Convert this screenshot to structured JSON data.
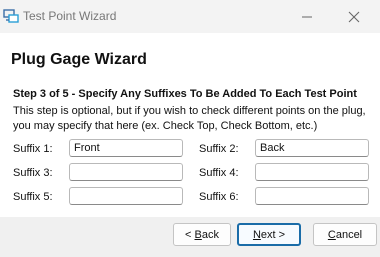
{
  "window": {
    "title": "Test Point Wizard",
    "minimize_icon": "minimize-icon",
    "close_icon": "close-icon",
    "app_icon": "wizard-app-icon"
  },
  "wizard": {
    "title": "Plug Gage Wizard",
    "step_heading": "Step 3 of 5 - Specify Any Suffixes To Be Added To Each Test Point",
    "step_description": "This step is optional, but if you wish to check different points on the plug, you may specify that here (ex. Check Top, Check Bottom, etc.)"
  },
  "suffixes": [
    {
      "label": "Suffix 1:",
      "value": "Front"
    },
    {
      "label": "Suffix 2:",
      "value": "Back"
    },
    {
      "label": "Suffix 3:",
      "value": ""
    },
    {
      "label": "Suffix 4:",
      "value": ""
    },
    {
      "label": "Suffix 5:",
      "value": ""
    },
    {
      "label": "Suffix 6:",
      "value": ""
    }
  ],
  "buttons": {
    "back": {
      "prefix": "< ",
      "mnemonic": "B",
      "rest": "ack"
    },
    "next": {
      "mnemonic": "N",
      "rest": "ext >"
    },
    "cancel": {
      "mnemonic": "C",
      "rest": "ancel"
    }
  }
}
